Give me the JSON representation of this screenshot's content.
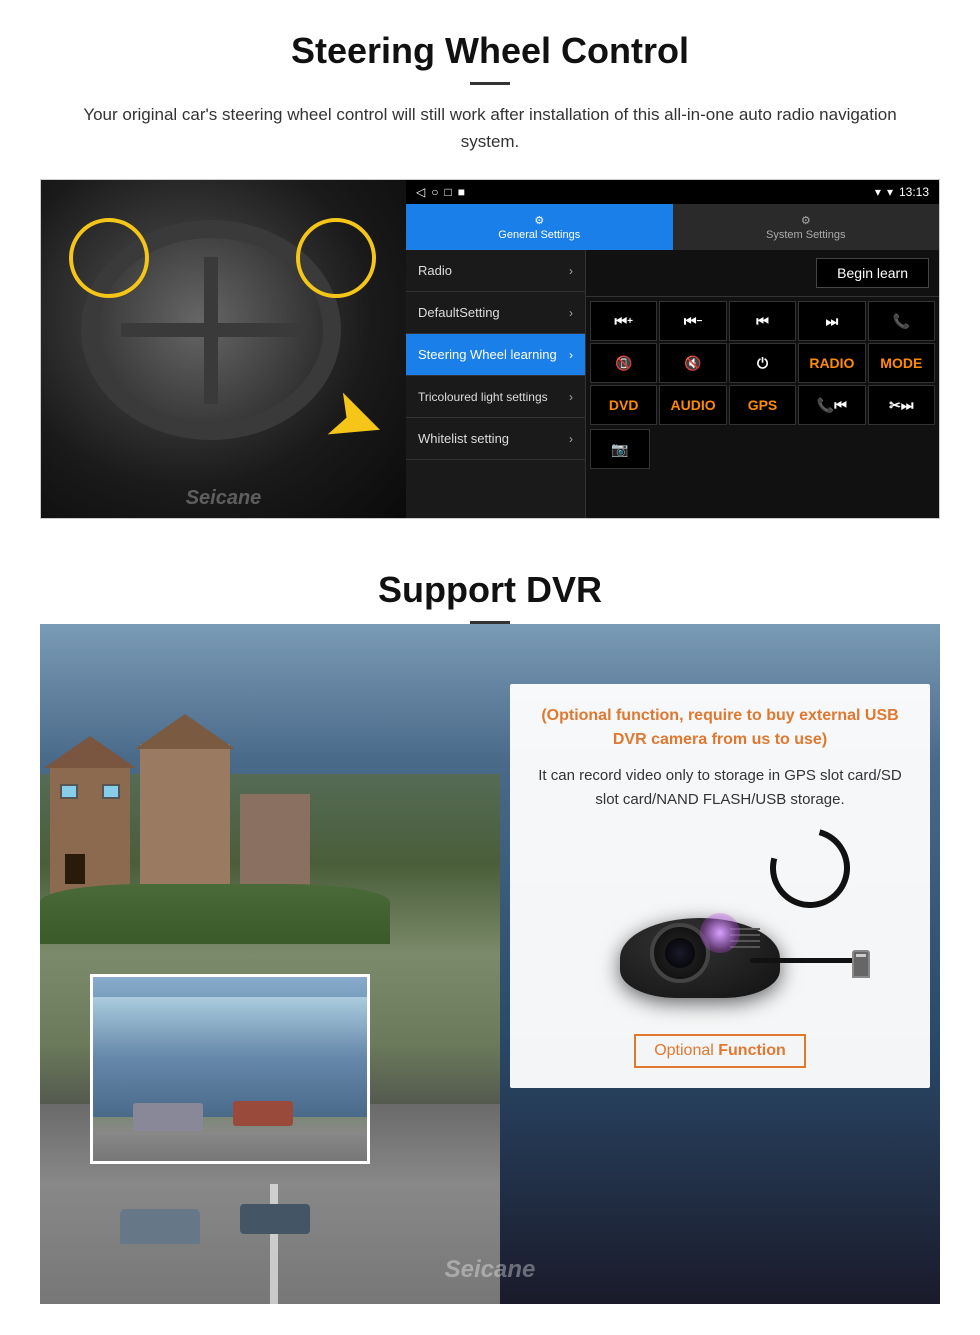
{
  "page": {
    "steering_section": {
      "title": "Steering Wheel Control",
      "description": "Your original car's steering wheel control will still work after installation of this all-in-one auto radio navigation system.",
      "android_ui": {
        "status_bar": {
          "time": "13:13",
          "signal_icon": "▼",
          "wifi_icon": "▾"
        },
        "nav_icons": [
          "◁",
          "○",
          "□",
          "■"
        ],
        "tabs": [
          {
            "label": "General Settings",
            "icon": "⚙",
            "active": true
          },
          {
            "label": "System Settings",
            "icon": "🔧",
            "active": false
          }
        ],
        "menu_items": [
          {
            "label": "Radio",
            "active": false
          },
          {
            "label": "DefaultSetting",
            "active": false
          },
          {
            "label": "Steering Wheel learning",
            "active": true
          },
          {
            "label": "Tricoloured light settings",
            "active": false
          },
          {
            "label": "Whitelist setting",
            "active": false
          }
        ],
        "begin_learn_label": "Begin learn",
        "control_buttons": [
          "⏮+",
          "⏮−",
          "⏮",
          "⏭",
          "☎",
          "↩",
          "🔊×",
          "⏻",
          "RADIO",
          "MODE",
          "DVD",
          "AUDIO",
          "GPS",
          "📞⏮",
          "✂⏭"
        ]
      }
    },
    "dvr_section": {
      "title": "Support DVR",
      "info_card": {
        "title": "(Optional function, require to buy external USB DVR camera from us to use)",
        "description": "It can record video only to storage in GPS slot card/SD slot card/NAND FLASH/USB storage.",
        "optional_badge_text_1": "Optional",
        "optional_badge_text_2": "Function"
      }
    },
    "watermark": "Seicane"
  }
}
